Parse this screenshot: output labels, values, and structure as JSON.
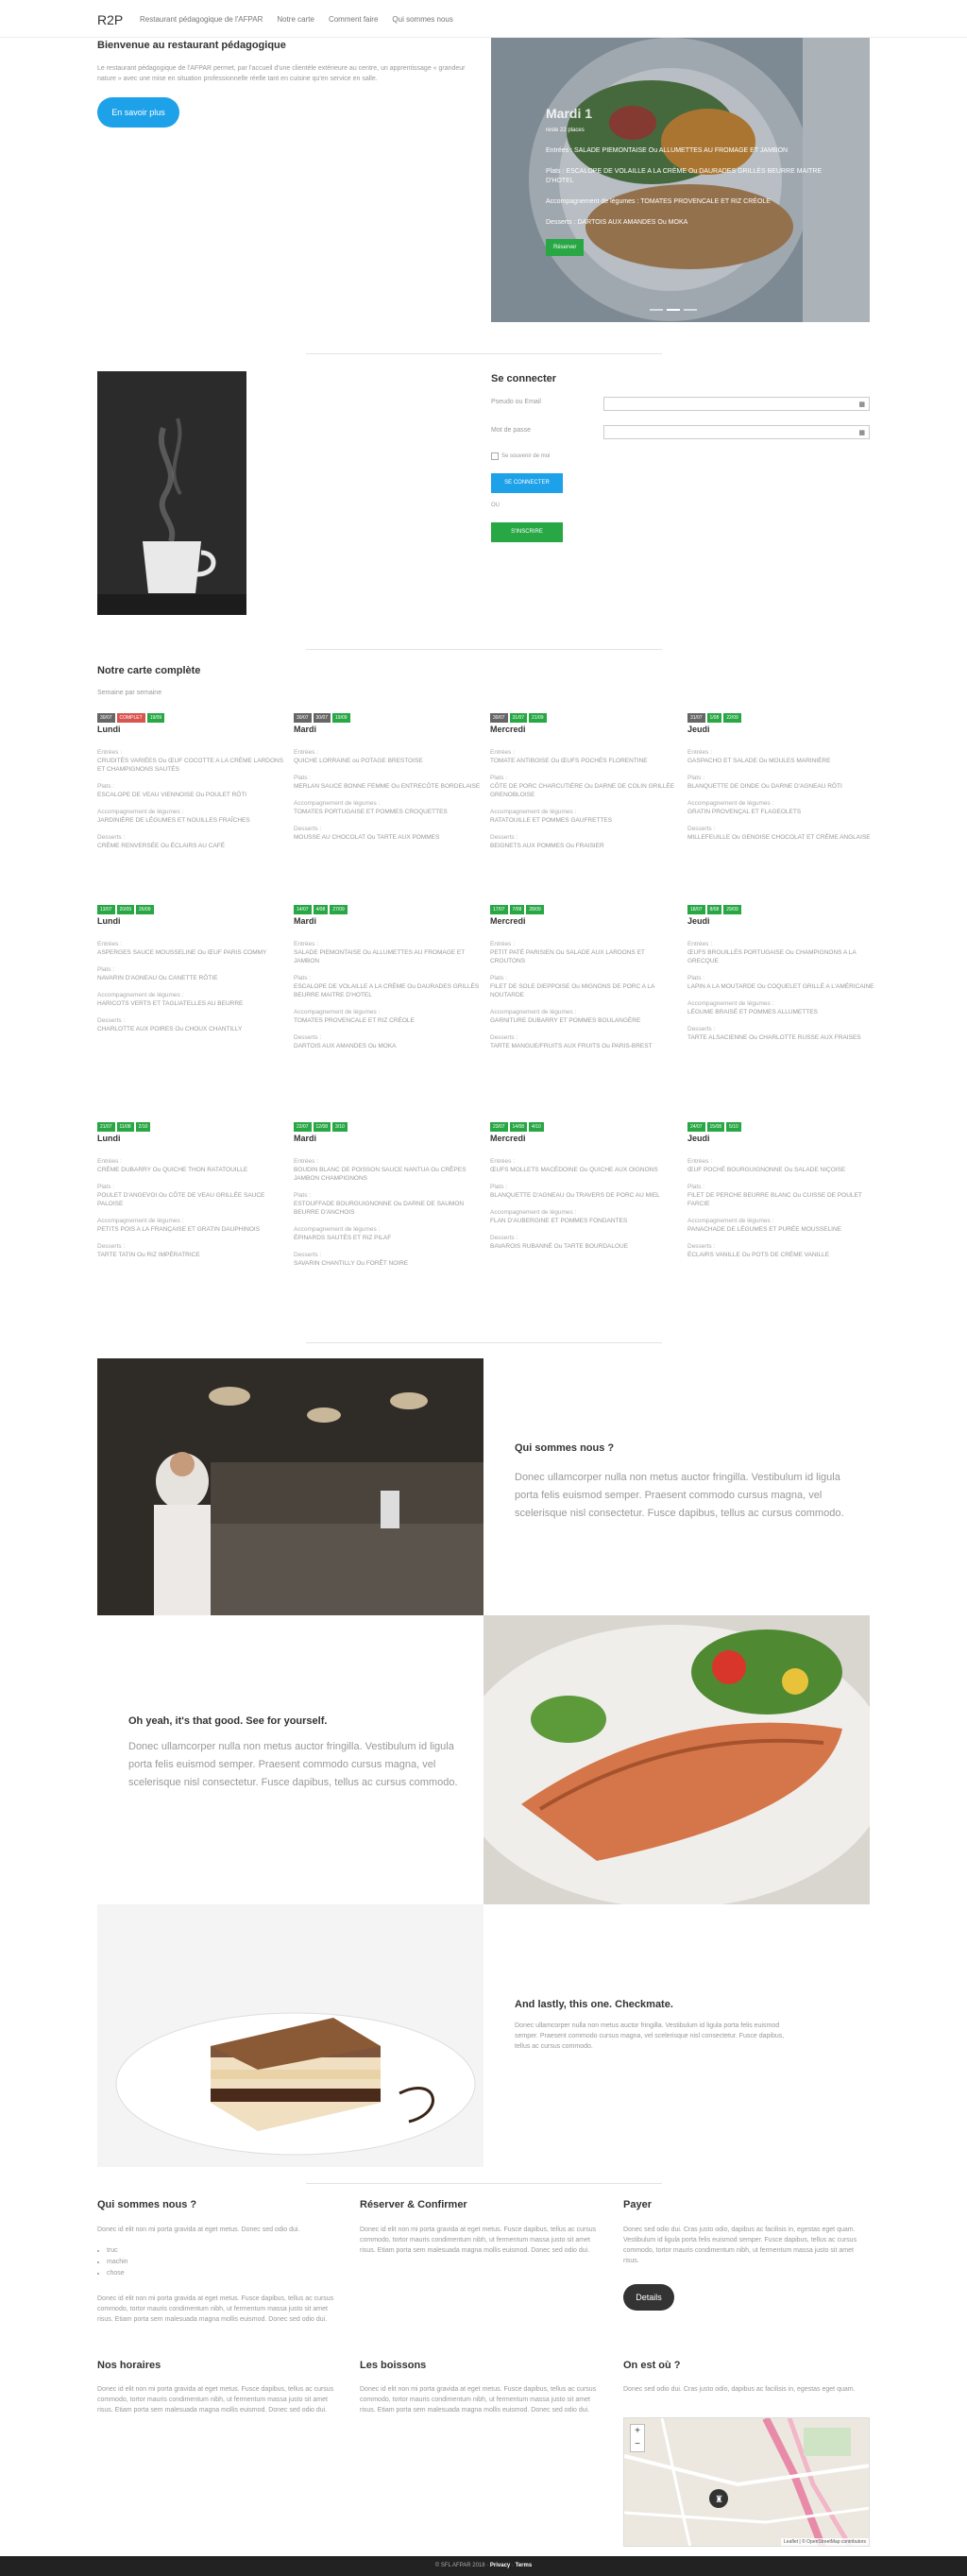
{
  "nav": {
    "brand": "R2P",
    "links": [
      "Restaurant pédagogique de l'AFPAR",
      "Notre carte",
      "Comment faire",
      "Qui sommes nous"
    ]
  },
  "hero": {
    "title": "Bienvenue au restaurant pédagogique",
    "text": "Le restaurant pédagogique de l'AFPAR permet, par l'accueil d'une clientèle extérieure au centre, un apprentissage « grandeur nature » avec une mise en situation professionnelle réelle tant en cuisine qu'en service en salle.",
    "button": "En savoir plus",
    "slide": {
      "day": "Mardi 1",
      "places": "reste 22 places",
      "entrees": "Entrées : SALADE PIEMONTAISE Ou ALLUMETTES AU FROMAGE ET JAMBON",
      "plats": "Plats : ESCALOPE DE VOLAILLE A LA CRÈME Ou DAURADES GRILLÉS BEURRE MAITRE D'HOTEL",
      "accomp": "Accompagnement de légumes : TOMATES PROVENCALE ET RIZ CRÉOLE",
      "desserts": "Desserts : DARTOIS AUX AMANDES Ou MOKA",
      "button": "Réserver"
    }
  },
  "login": {
    "title": "Se connecter",
    "email_label": "Pseudo ou Email",
    "password_label": "Mot de passe",
    "remember": "Se souvenir de moi",
    "connect": "SE CONNECTER",
    "or": "OU",
    "register": "S'INSCRIRE"
  },
  "carte": {
    "title": "Notre carte complète",
    "subtitle": "Semaine par semaine",
    "labels": {
      "entrees": "Entrées :",
      "plats": "Plats :",
      "accomp": "Accompagnement de légumes :",
      "desserts": "Desserts :"
    },
    "weeks": [
      [
        {
          "badges": [
            [
              "30/07",
              "#666"
            ],
            [
              "COMPLET",
              "#d9534f"
            ],
            [
              "19/09",
              "#28a745"
            ]
          ],
          "day": "Lundi",
          "entrees": "CRUDITÉS VARIÉES Ou ŒUF COCOTTE A LA CRÈME LARDONS ET CHAMPIGNONS SAUTÉS",
          "plats": "ESCALOPE DE VEAU VIENNOISE Ou POULET RÔTI",
          "accomp": "JARDINIÈRE DE LÉGUMES ET NOUILLES FRAÎCHES",
          "desserts": "CRÈME RENVERSÉE Ou ÉCLAIRS AU CAFÉ"
        },
        {
          "badges": [
            [
              "30/07",
              "#666"
            ],
            [
              "30/07",
              "#666"
            ],
            [
              "19/09",
              "#28a745"
            ]
          ],
          "day": "Mardi",
          "entrees": "QUICHE LORRAINE ou POTAGE BRESTOISE",
          "plats": "MERLAN SAUCE BONNE FEMME Ou ENTRECÔTE BORDELAISE",
          "accomp": "TOMATES PORTUGAISE ET POMMES CROQUETTES",
          "desserts": "MOUSSE AU CHOCOLAT Ou TARTE AUX POMMES"
        },
        {
          "badges": [
            [
              "30/07",
              "#666"
            ],
            [
              "31/07",
              "#28a745"
            ],
            [
              "21/09",
              "#28a745"
            ]
          ],
          "day": "Mercredi",
          "entrees": "TOMATE ANTIBOISE Ou ŒUFS POCHÉS FLORENTINE",
          "plats": "CÔTE DE PORC CHARCUTIÈRE Ou DARNE DE COLIN GRILLÉE GRENOBLOISE",
          "accomp": "RATATOUILLE ET POMMES GAUFRETTES",
          "desserts": "BEIGNETS AUX POMMES Ou FRAISIER"
        },
        {
          "badges": [
            [
              "31/07",
              "#666"
            ],
            [
              "1/08",
              "#28a745"
            ],
            [
              "22/09",
              "#28a745"
            ]
          ],
          "day": "Jeudi",
          "entrees": "GASPACHO ET SALADE Ou MOULES MARINIÈRE",
          "plats": "BLANQUETTE DE DINDE Ou DARNE D'AGNEAU RÔTI",
          "accomp": "GRATIN PROVENÇAL ET FLAGEOLETS",
          "desserts": "MILLEFEUILLE Ou GENOISE CHOCOLAT ET CRÈME ANGLAISE"
        }
      ],
      [
        {
          "badges": [
            [
              "13/07",
              "#28a745"
            ],
            [
              "20/09",
              "#28a745"
            ],
            [
              "26/09",
              "#28a745"
            ]
          ],
          "day": "Lundi",
          "entrees": "ASPERGES SAUCE MOUSSELINE Ou ŒUF PARIS COMMY",
          "plats": "NAVARIN D'AGNEAU Ou CANETTE RÔTIE",
          "accomp": "HARICOTS VERTS ET TAGLIATELLES AU BEURRE",
          "desserts": "CHARLOTTE AUX POIRES Ou CHOUX CHANTILLY"
        },
        {
          "badges": [
            [
              "14/07",
              "#28a745"
            ],
            [
              "4/08",
              "#28a745"
            ],
            [
              "27/09",
              "#28a745"
            ]
          ],
          "day": "Mardi",
          "entrees": "SALADE PIEMONTAISE Ou ALLUMETTES AU FROMAGE ET JAMBON",
          "plats": "ESCALOPE DE VOLAILLE A LA CRÈME Ou DAURADES GRILLÉS BEURRE MAITRE D'HOTEL",
          "accomp": "TOMATES PROVENCALE ET RIZ CRÉOLE",
          "desserts": "DARTOIS AUX AMANDES Ou MOKA"
        },
        {
          "badges": [
            [
              "17/07",
              "#28a745"
            ],
            [
              "7/08",
              "#28a745"
            ],
            [
              "28/09",
              "#28a745"
            ]
          ],
          "day": "Mercredi",
          "entrees": "PETIT PATÉ PARISIEN Ou SALADE AUX LARDONS ET CROUTONS",
          "plats": "FILET DE SOLE DIEPPOISE Ou MIGNONS DE PORC A LA NOUTARDE",
          "accomp": "GARNITURE DUBARRY ET POMMES BOULANGÈRE",
          "desserts": "TARTE MANGUE/FRUITS AUX FRUITS Ou PARIS-BREST"
        },
        {
          "badges": [
            [
              "18/07",
              "#28a745"
            ],
            [
              "8/08",
              "#28a745"
            ],
            [
              "29/09",
              "#28a745"
            ]
          ],
          "day": "Jeudi",
          "entrees": "ŒUFS BROUILLÉS PORTUGAISE Ou CHAMPIGNONS A LA GRECQUE",
          "plats": "LAPIN A LA MOUTARDE Ou COQUELET GRILLÉ A L'AMÉRICAINE",
          "accomp": "LÉGUME BRAISÉ ET POMMES ALLUMETTES",
          "desserts": "TARTE ALSACIENNE Ou CHARLOTTE RUSSE AUX FRAISES"
        }
      ],
      [
        {
          "badges": [
            [
              "21/07",
              "#28a745"
            ],
            [
              "11/08",
              "#28a745"
            ],
            [
              "2/10",
              "#28a745"
            ]
          ],
          "day": "Lundi",
          "entrees": "CRÈME DUBARRY Ou QUICHE THON RATATOUILLE",
          "plats": "POULET D'ANGEVOI Ou CÔTE DE VEAU GRILLÉE SAUCE PALOISE",
          "accomp": "PETITS POIS A LA FRANÇAISE ET GRATIN DAUPHINOIS",
          "desserts": "TARTE TATIN Ou RIZ IMPÉRATRICE"
        },
        {
          "badges": [
            [
              "22/07",
              "#28a745"
            ],
            [
              "12/08",
              "#28a745"
            ],
            [
              "3/10",
              "#28a745"
            ]
          ],
          "day": "Mardi",
          "entrees": "BOUDIN BLANC DE POISSON SAUCE NANTUA Ou CRÊPES JAMBON CHAMPIGNONS",
          "plats": "ESTOUFFADE BOURGUIGNONNE Ou DARNE DE SAUMON BEURRE D'ANCHOIS",
          "accomp": "ÉPINARDS SAUTÉS ET RIZ PILAF",
          "desserts": "SAVARIN CHANTILLY Ou FORÊT NOIRE"
        },
        {
          "badges": [
            [
              "23/07",
              "#28a745"
            ],
            [
              "14/08",
              "#28a745"
            ],
            [
              "4/10",
              "#28a745"
            ]
          ],
          "day": "Mercredi",
          "entrees": "ŒUFS MOLLETS MACÉDOINE Ou QUICHE AUX OIGNONS",
          "plats": "BLANQUETTE D'AGNEAU Ou TRAVERS DE PORC AU MIEL",
          "accomp": "FLAN D'AUBERGINE ET POMMES FONDANTES",
          "desserts": "BAVAROIS RUBANNÉ Ou TARTE BOURDALOUE"
        },
        {
          "badges": [
            [
              "24/07",
              "#28a745"
            ],
            [
              "15/08",
              "#28a745"
            ],
            [
              "5/10",
              "#28a745"
            ]
          ],
          "day": "Jeudi",
          "entrees": "ŒUF POCHÉ BOURGUIGNONNE Ou SALADE NIÇOISE",
          "plats": "FILET DE PERCHE BEURRE BLANC Ou CUISSE DE POULET FARCIE",
          "accomp": "PANACHADE DE LÉGUMES ET PURÉE MOUSSELINE",
          "desserts": "ÉCLAIRS VANILLE Ou POTS DE CRÈME VANILLE"
        }
      ]
    ]
  },
  "qui": {
    "title": "Qui sommes nous ?",
    "text": "Donec ullamcorper nulla non metus auctor fringilla. Vestibulum id ligula porta felis euismod semper. Praesent commodo cursus magna, vel scelerisque nisl consectetur. Fusce dapibus, tellus ac cursus commodo."
  },
  "oh": {
    "title": "Oh yeah, it's that good. See for yourself.",
    "text": "Donec ullamcorper nulla non metus auctor fringilla. Vestibulum id ligula porta felis euismod semper. Praesent commodo cursus magna, vel scelerisque nisl consectetur. Fusce dapibus, tellus ac cursus commodo."
  },
  "last": {
    "title": "And lastly, this one. Checkmate.",
    "text": "Donec ullamcorper nulla non metus auctor fringilla. Vestibulum id ligula porta felis euismod semper. Praesent commodo cursus magna, vel scelerisque nisl consectetur. Fusce dapibus, tellus ac cursus commodo."
  },
  "footer": {
    "qui_title": "Qui sommes nous ?",
    "qui_text": "Donec id elit non mi porta gravida at eget metus. Donec sed odio dui.",
    "qui_list": [
      "truc",
      "machin",
      "chose"
    ],
    "qui_text2": "Donec id elit non mi porta gravida at eget metus. Fusce dapibus, tellus ac cursus commodo, tortor mauris condimentum nibh, ut fermentum massa justo sit amet risus. Etiam porta sem malesuada magna mollis euismod. Donec sed odio dui.",
    "reserver_title": "Réserver & Confirmer",
    "reserver_text": "Donec id elit non mi porta gravida at eget metus. Fusce dapibus, tellus ac cursus commodo, tortor mauris condimentum nibh, ut fermentum massa justo sit amet risus. Etiam porta sem malesuada magna mollis euismod. Donec sed odio dui.",
    "payer_title": "Payer",
    "payer_text": "Donec sed odio dui. Cras justo odio, dapibus ac facilisis in, egestas eget quam. Vestibulum id ligula porta felis euismod semper. Fusce dapibus, tellus ac cursus commodo, tortor mauris condimentum nibh, ut fermentum massa justo sit amet risus.",
    "details": "Details",
    "horaires_title": "Nos horaires",
    "horaires_text": "Donec id elit non mi porta gravida at eget metus. Fusce dapibus, tellus ac cursus commodo, tortor mauris condimentum nibh, ut fermentum massa justo sit amet risus. Etiam porta sem malesuada magna mollis euismod. Donec sed odio dui.",
    "boissons_title": "Les boissons",
    "boissons_text": "Donec id elit non mi porta gravida at eget metus. Fusce dapibus, tellus ac cursus commodo, tortor mauris condimentum nibh, ut fermentum massa justo sit amet risus. Etiam porta sem malesuada magna mollis euismod. Donec sed odio dui.",
    "ou_title": "On est où ?",
    "ou_text": "Donec sed odio dui. Cras justo odio, dapibus ac facilisis in, egestas eget quam.",
    "map_attr": "Leaflet | © OpenStreetMap contributors",
    "copyright": "© SFL AFPAR 2018 ·",
    "privacy": "Privacy",
    "terms": "Terms"
  }
}
